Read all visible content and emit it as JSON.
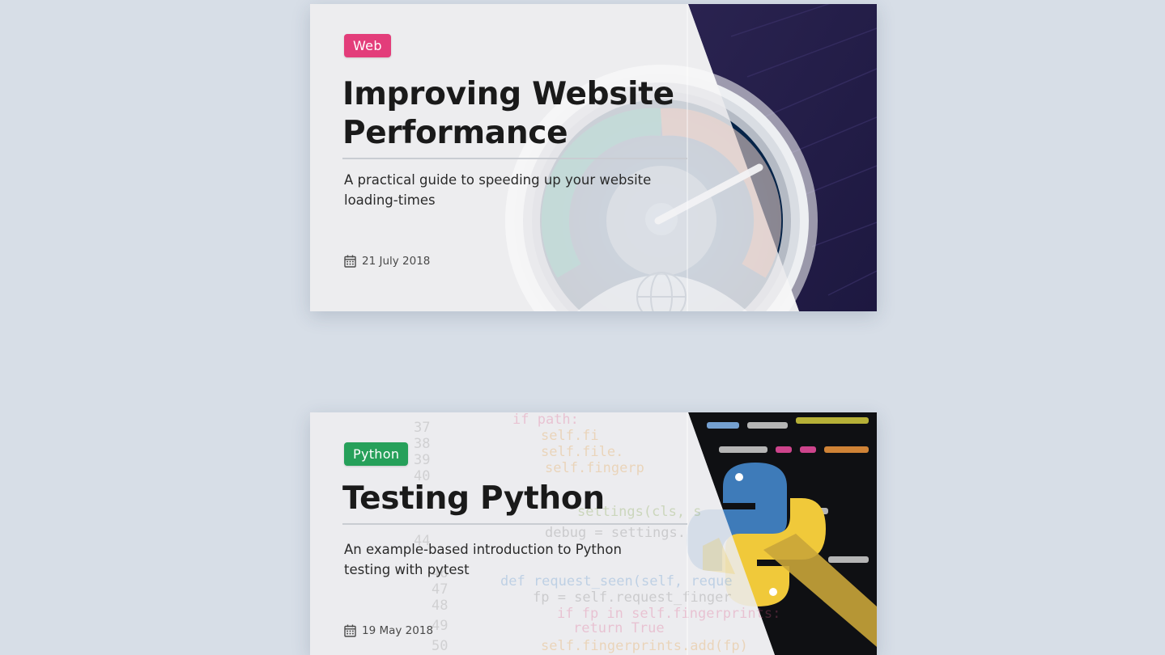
{
  "posts": [
    {
      "tag": "Web",
      "tag_color": "#e33d7a",
      "title": "Improving Website Performance",
      "description": "A practical guide to speeding up your website loading-times",
      "date": "21 July 2018",
      "date_icon": "calendar-icon",
      "image": "speedometer-gauge-illustration"
    },
    {
      "tag": "Python",
      "tag_color": "#26a05a",
      "title": "Testing Python",
      "description": "An example-based introduction to Python testing with pytest",
      "date": "19 May 2018",
      "date_icon": "calendar-icon",
      "image": "python-code-with-logo",
      "code_snippet": {
        "line_numbers": [
          "37",
          "38",
          "39",
          "40",
          "44",
          "46",
          "47",
          "48",
          "49",
          "50"
        ],
        "lines": [
          "if path:",
          "self.file",
          "self.file.",
          "self.fingerp",
          "settings(cls, s",
          "debug = settings.",
          "def request_seen(self, reque",
          "fp = self.request_finger",
          "if fp in self.fingerprints:",
          "return True",
          "self.fingerprints.add(fp)"
        ]
      }
    }
  ]
}
